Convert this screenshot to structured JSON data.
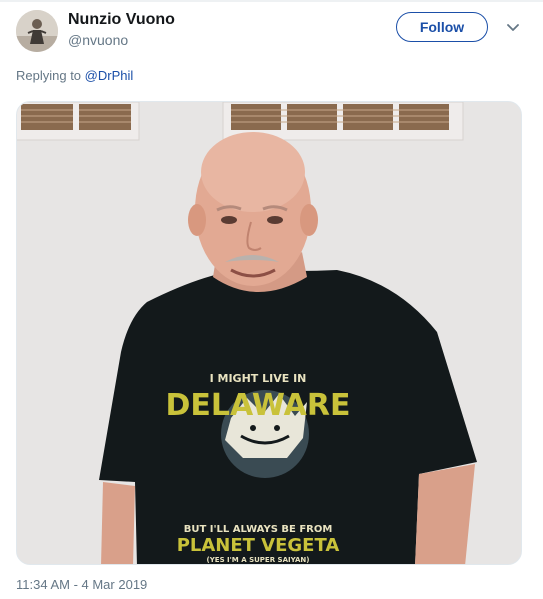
{
  "tweet": {
    "author_name": "Nunzio Vuono",
    "author_handle": "@nvuono",
    "follow_label": "Follow",
    "replying_prefix": "Replying to",
    "replying_to": "@DrPhil",
    "timestamp": "11:34 AM - 4 Mar 2019"
  },
  "photo": {
    "shirt_line1": "I MIGHT LIVE IN",
    "shirt_line2": "DELAWARE",
    "shirt_line3": "BUT I'LL ALWAYS BE FROM",
    "shirt_line4": "PLANET VEGETA",
    "shirt_line5": "(YES I'M A SUPER SAIYAN)"
  },
  "colors": {
    "link": "#1b4fa8",
    "muted": "#657786",
    "shirt": "#13191b",
    "shirt_print": "#c9c23a"
  },
  "icons": [
    "avatar",
    "chevron-down-icon"
  ]
}
